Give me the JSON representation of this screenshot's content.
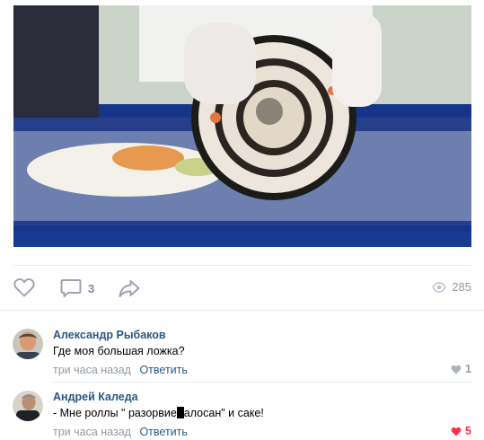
{
  "post": {
    "actions": {
      "comments_count": "3"
    },
    "views_count": "285"
  },
  "comments": [
    {
      "author": "Александр Рыбаков",
      "text": "Где моя большая ложка?",
      "time": "три часа назад",
      "reply_label": "Ответить",
      "likes": "1",
      "liked": false
    },
    {
      "author": "Андрей Каледа",
      "text_before": "- Мне роллы \" разорвие",
      "text_after": "алосан\" и саке!",
      "time": "три часа назад",
      "reply_label": "Ответить",
      "likes": "5",
      "liked": true
    }
  ],
  "colors": {
    "link": "#2a5885",
    "muted": "#939ba4",
    "icon": "#99a2ad",
    "liked": "#ff3347"
  }
}
